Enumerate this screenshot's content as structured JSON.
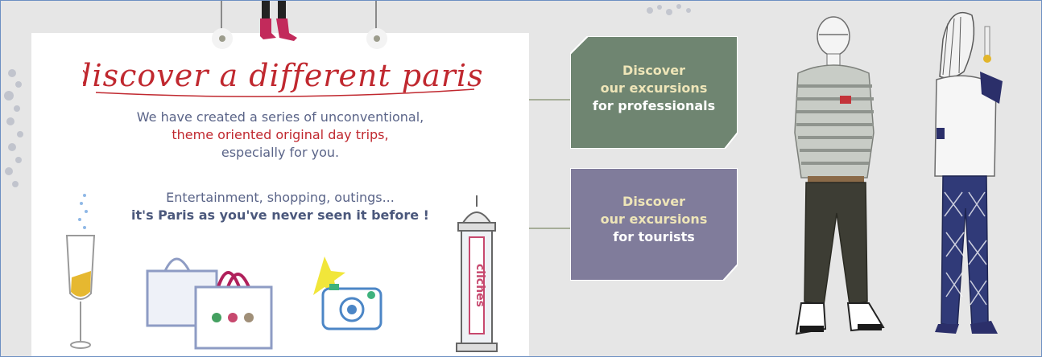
{
  "promo": {
    "headline": "discover a different paris!",
    "intro_line1": "We have created a series of unconventional,",
    "intro_line2": "theme oriented original day trips,",
    "intro_line3": "especially for you.",
    "teaser_line1": "Entertainment, shopping, outings...",
    "teaser_line2": "it's Paris as you've never seen it before !",
    "column_lettering": "cliches"
  },
  "cta": {
    "professionals": {
      "line1": "Discover",
      "line2": "our excursions",
      "line3": "for professionals"
    },
    "tourists": {
      "line1": "Discover",
      "line2": "our excursions",
      "line3": "for tourists"
    }
  },
  "colors": {
    "headline_red": "#c0282f",
    "text_blue": "#5a6488",
    "professionals_panel": "#6f8571",
    "tourists_panel": "#807c9b",
    "panel_text_cream": "#eee5b8",
    "frame_border": "#6d8fc2"
  },
  "icons": [
    "champagne-glass-icon",
    "shopping-bags-icon",
    "camera-icon",
    "advertising-column-icon",
    "pink-boots-icon",
    "man-figure-illustration",
    "woman-figure-illustration"
  ]
}
